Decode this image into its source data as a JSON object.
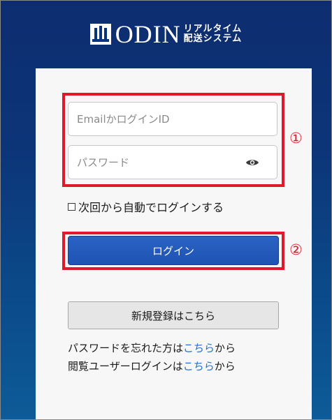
{
  "logo": {
    "word": "ODIN",
    "tagline_top": "リアルタイム",
    "tagline_bottom": "配送システム"
  },
  "form": {
    "email_placeholder": "EmailかログインID",
    "password_placeholder": "パスワード",
    "remember_label": "次回から自動でログインする",
    "login_button": "ログイン",
    "register_button": "新規登録はこちら"
  },
  "links": {
    "forgot_prefix": "パスワードを忘れた方は",
    "forgot_link": "こちら",
    "forgot_suffix": "から",
    "viewer_prefix": "閲覧ユーザーログインは",
    "viewer_link": "こちら",
    "viewer_suffix": "から"
  },
  "annotations": {
    "one": "①",
    "two": "②"
  },
  "colors": {
    "brand_navy": "#0c3578",
    "login_button": "#2a63c4",
    "annotation_red": "#e0192a",
    "link_blue": "#1e6fd9"
  },
  "icons": {
    "logo": "odin-logo-icon",
    "eye": "eye-icon"
  }
}
